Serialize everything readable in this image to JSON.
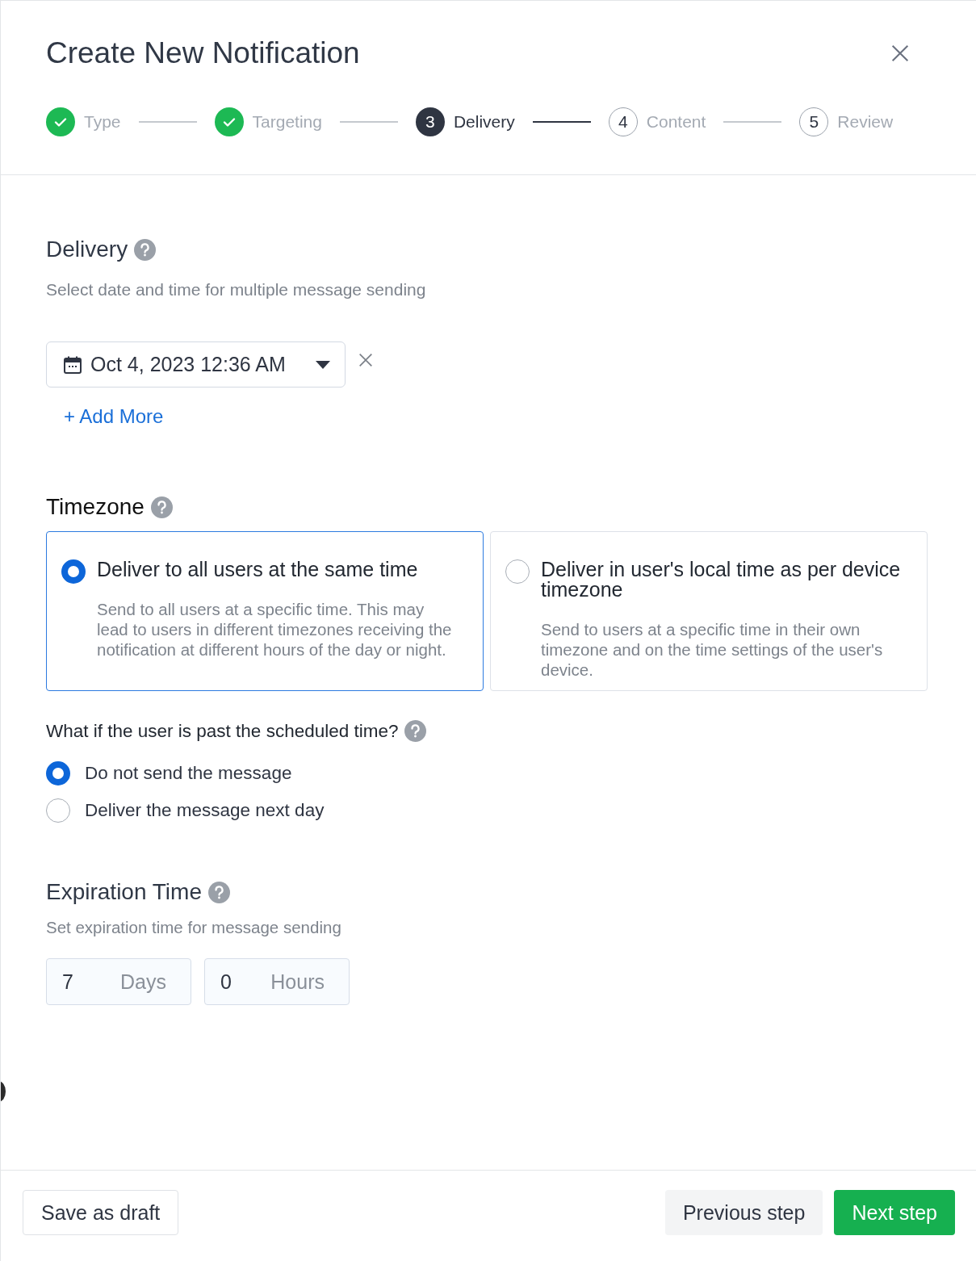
{
  "dialog": {
    "title": "Create New Notification"
  },
  "steps": [
    {
      "label": "Type",
      "completed": true,
      "selected": false
    },
    {
      "label": "Targeting",
      "completed": true,
      "selected": false
    },
    {
      "marker": "3",
      "label": "Delivery",
      "completed": false,
      "selected": true
    },
    {
      "marker": "4",
      "label": "Content",
      "completed": false,
      "selected": false
    },
    {
      "marker": "5",
      "label": "Review",
      "completed": false,
      "selected": false
    }
  ],
  "delivery": {
    "heading": "Delivery",
    "description": "Select date and time for multiple message sending",
    "dates": [
      "Oct 4, 2023 12:36 AM"
    ],
    "add_more": "+ Add More"
  },
  "timezone": {
    "heading": "Timezone",
    "options": [
      {
        "title": "Deliver to all users at the same time",
        "description": "Send to all users at a specific time. This may lead to users in different timezones receiving the notification at different hours of the day or night.",
        "selected": true
      },
      {
        "title": "Deliver in user's local time as per device timezone",
        "description": "Send to users at a specific time in their own timezone and on the time settings of the user's device.",
        "selected": false
      }
    ]
  },
  "past_time": {
    "question": "What if the user is past the scheduled time?",
    "options": [
      {
        "label": "Do not send the message",
        "selected": true
      },
      {
        "label": "Deliver the message next day",
        "selected": false
      }
    ]
  },
  "expiration": {
    "heading": "Expiration Time",
    "description": "Set expiration time for message sending",
    "fields": [
      {
        "value": "7",
        "unit": "Days"
      },
      {
        "value": "0",
        "unit": "Hours"
      }
    ]
  },
  "footer": {
    "save_draft": "Save as draft",
    "previous": "Previous step",
    "next": "Next step"
  }
}
